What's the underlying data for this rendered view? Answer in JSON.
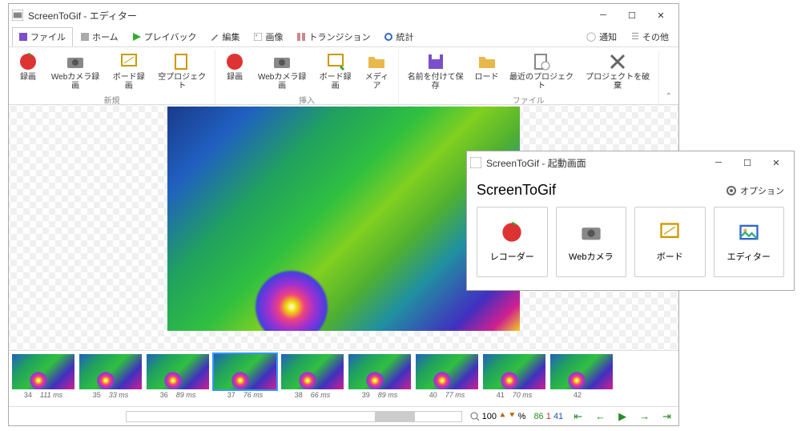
{
  "editor": {
    "title": "ScreenToGif - エディター",
    "tabs": {
      "file": "ファイル",
      "home": "ホーム",
      "playback": "プレイバック",
      "edit": "編集",
      "image": "画像",
      "transition": "トランジション",
      "stats": "統計",
      "notify": "通知",
      "other": "その他"
    },
    "ribbon": {
      "group_new": "新規",
      "group_insert": "挿入",
      "group_file": "ファイル",
      "new_record": "録画",
      "new_webcam": "Webカメラ録画",
      "new_board": "ボード録画",
      "new_blank": "空プロジェクト",
      "ins_record": "録画",
      "ins_webcam": "Webカメラ録画",
      "ins_board": "ボード録画",
      "ins_media": "メディア",
      "file_saveas": "名前を付けて保存",
      "file_load": "ロード",
      "file_recent": "最近のプロジェクト",
      "file_discard": "プロジェクトを破棄"
    },
    "thumbs": [
      {
        "idx": "34",
        "ms": "111 ms"
      },
      {
        "idx": "35",
        "ms": "33 ms"
      },
      {
        "idx": "36",
        "ms": "89 ms"
      },
      {
        "idx": "37",
        "ms": "76 ms",
        "sel": true
      },
      {
        "idx": "38",
        "ms": "66 ms"
      },
      {
        "idx": "39",
        "ms": "89 ms"
      },
      {
        "idx": "40",
        "ms": "77 ms"
      },
      {
        "idx": "41",
        "ms": "70 ms"
      },
      {
        "idx": "42",
        "ms": ""
      }
    ],
    "status": {
      "zoom_value": "100",
      "zoom_pct": "%",
      "frames_total": "86",
      "frames_sel": "1",
      "frames_cur": "41"
    }
  },
  "launcher": {
    "title": "ScreenToGif - 起動画面",
    "heading": "ScreenToGif",
    "options": "オプション",
    "cards": {
      "recorder": "レコーダー",
      "webcam": "Webカメラ",
      "board": "ボード",
      "editor": "エディター"
    }
  }
}
